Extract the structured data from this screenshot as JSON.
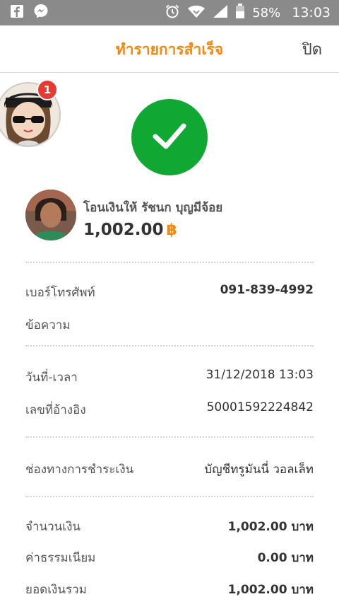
{
  "status_bar": {
    "battery": "58%",
    "time": "13:03"
  },
  "header": {
    "title": "ทำรายการสำเร็จ",
    "close_label": "ปิด"
  },
  "chat_bubble": {
    "badge_count": "1"
  },
  "recipient": {
    "line": "โอนเงินให้ รัชนก บุญมีจ้อย",
    "amount": "1,002.00",
    "currency_symbol": "฿"
  },
  "details": {
    "phone_label": "เบอร์โทรศัพท์",
    "phone_value": "091-839-4992",
    "message_label": "ข้อความ",
    "message_value": "",
    "datetime_label": "วันที่-เวลา",
    "datetime_value": "31/12/2018 13:03",
    "ref_label": "เลขที่อ้างอิง",
    "ref_value": "50001592224842",
    "channel_label": "ช่องทางการชำระเงิน",
    "channel_value": "บัญชีทรูมันนี่ วอลเล็ท",
    "amount_label": "จำนวนเงิน",
    "amount_value": "1,002.00 บาท",
    "fee_label": "ค่าธรรมเนียม",
    "fee_value": "0.00 บาท",
    "total_label": "ยอดเงินรวม",
    "total_value": "1,002.00 บาท"
  },
  "colors": {
    "accent": "#f5860b",
    "success": "#10a832",
    "badge": "#e63b33",
    "status_bar": "#8a8a8a"
  },
  "icons": [
    "facebook-icon",
    "messenger-icon",
    "alarm-icon",
    "wifi-icon",
    "signal-icon",
    "battery-icon",
    "check-icon"
  ]
}
